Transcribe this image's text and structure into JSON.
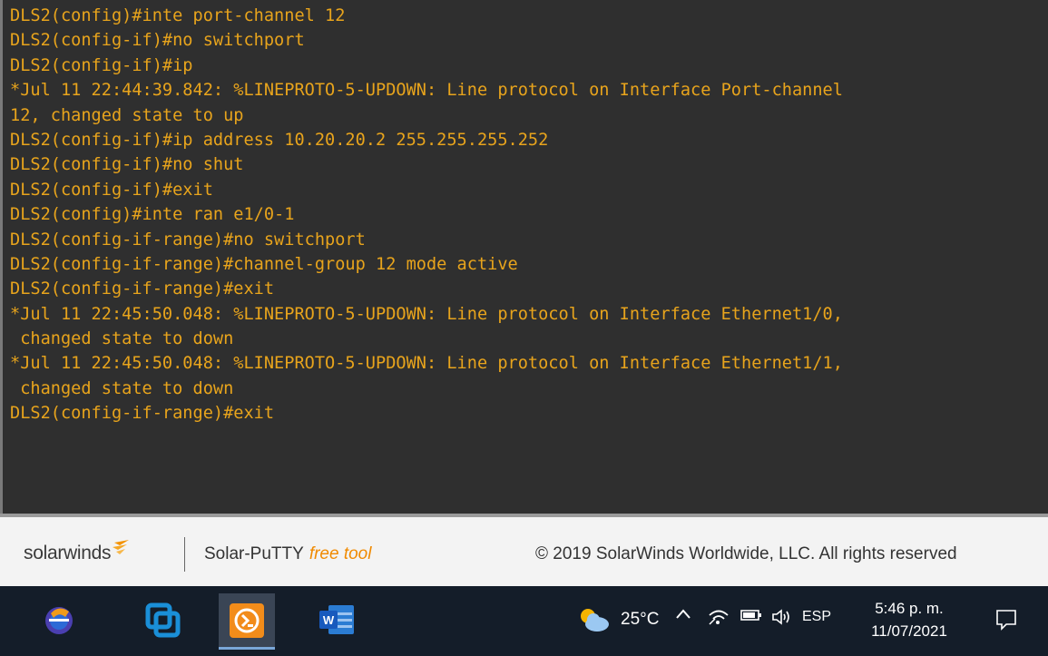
{
  "terminal": {
    "lines": [
      "DLS2(config)#inte port-channel 12",
      "DLS2(config-if)#no switchport",
      "DLS2(config-if)#ip",
      "*Jul 11 22:44:39.842: %LINEPROTO-5-UPDOWN: Line protocol on Interface Port-channel",
      "12, changed state to up",
      "DLS2(config-if)#ip address 10.20.20.2 255.255.255.252",
      "DLS2(config-if)#no shut",
      "DLS2(config-if)#exit",
      "DLS2(config)#inte ran e1/0-1",
      "DLS2(config-if-range)#no switchport",
      "DLS2(config-if-range)#channel-group 12 mode active",
      "DLS2(config-if-range)#exit",
      "*Jul 11 22:45:50.048: %LINEPROTO-5-UPDOWN: Line protocol on Interface Ethernet1/0,",
      " changed state to down",
      "*Jul 11 22:45:50.048: %LINEPROTO-5-UPDOWN: Line protocol on Interface Ethernet1/1,",
      " changed state to down",
      "DLS2(config-if-range)#exit"
    ],
    "text_color": "#e8a41c"
  },
  "footer": {
    "brand": "solarwinds",
    "product": "Solar-PuTTY",
    "product_tag": "free tool",
    "copyright": "© 2019 SolarWinds Worldwide, LLC. All rights reserved"
  },
  "taskbar": {
    "apps": [
      {
        "name": "eclipse-icon"
      },
      {
        "name": "vmware-icon"
      },
      {
        "name": "solar-putty-icon"
      },
      {
        "name": "word-icon"
      }
    ],
    "weather_temp": "25°C",
    "language": "ESP",
    "time": "5:46 p. m.",
    "date": "11/07/2021"
  }
}
